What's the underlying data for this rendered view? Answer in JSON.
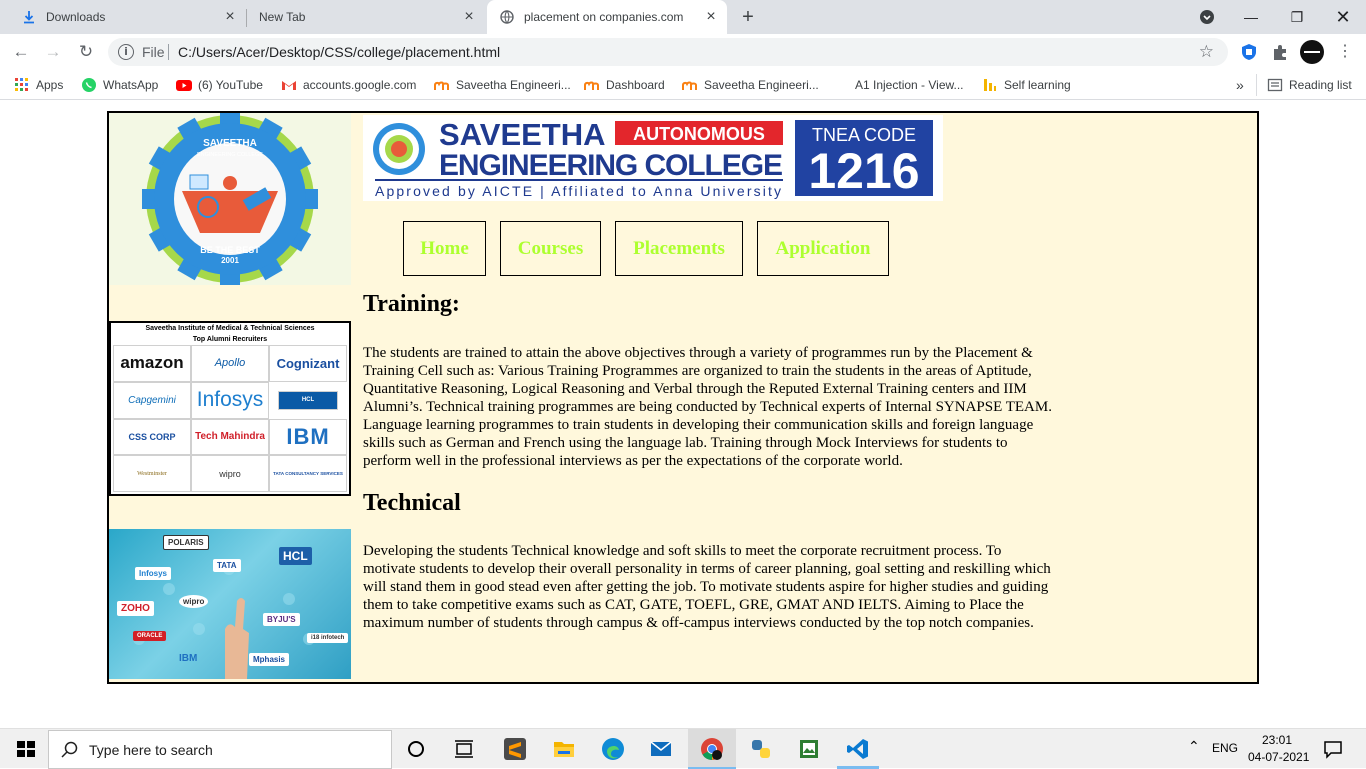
{
  "browser": {
    "tabs": [
      {
        "title": "Downloads",
        "icon": "download-icon"
      },
      {
        "title": "New Tab",
        "icon": ""
      },
      {
        "title": "placement on companies.com",
        "icon": "globe-icon",
        "active": true
      }
    ],
    "address": {
      "scheme": "File",
      "url": "C:/Users/Acer/Desktop/CSS/college/placement.html"
    },
    "bookmarks": [
      {
        "label": "Apps",
        "icon": "apps-grid-icon"
      },
      {
        "label": "WhatsApp",
        "icon": "whatsapp-icon"
      },
      {
        "label": "(6) YouTube",
        "icon": "youtube-icon"
      },
      {
        "label": "accounts.google.com",
        "icon": "gmail-icon"
      },
      {
        "label": "Saveetha Engineeri...",
        "icon": "moodle-icon"
      },
      {
        "label": "Dashboard",
        "icon": "moodle-icon"
      },
      {
        "label": "Saveetha Engineeri...",
        "icon": "moodle-icon"
      },
      {
        "label": "A1 Injection - View...",
        "icon": ""
      },
      {
        "label": "Self learning",
        "icon": "bar-icon"
      }
    ],
    "overflow": "»",
    "reading_list": "Reading list"
  },
  "page": {
    "logo": {
      "top": "SAVEETHA",
      "sub": "ENGINEERING COLLEGE",
      "motto": "BE THE BEST",
      "year": "2001"
    },
    "banner": {
      "line1": "SAVEETHA",
      "badge": "AUTONOMOUS",
      "line2": "ENGINEERING COLLEGE",
      "line3": "Approved by AICTE  |  Affiliated to Anna University",
      "tnea_label": "TNEA CODE",
      "tnea_code": "1216"
    },
    "nav": [
      "Home",
      "Courses",
      "Placements",
      "Application"
    ],
    "recruiters": {
      "header1": "Saveetha Institute of Medical & Technical Sciences",
      "header2": "Top Alumni Recruiters",
      "logos": [
        "amazon",
        "Apollo",
        "Cognizant",
        "Capgemini",
        "Infosys",
        "HCL",
        "CSS CORP",
        "Tech Mahindra",
        "IBM",
        "Westminster",
        "wipro",
        "TATA CONSULTANCY SERVICES"
      ]
    },
    "collage": [
      "POLARIS",
      "HCL",
      "Infosys",
      "TATA",
      "ZOHO",
      "wipro",
      "BYJU'S",
      "ORACLE",
      "IBM",
      "Mphasis",
      "i18 infotech"
    ],
    "sections": [
      {
        "heading": "Training:",
        "body": "The students are trained to attain the above objectives through a variety of programmes run by the Placement & Training Cell such as: Various Training Programmes are organized to train the students in the areas of Aptitude, Quantitative Reasoning, Logical Reasoning and Verbal through the Reputed External Training centers and IIM Alumni’s. Technical training programmes are being conducted by Technical experts of Internal SYNAPSE TEAM. Language learning programmes to train students in developing their communication skills and foreign language skills such as German and French using the language lab. Training through Mock Interviews for students to perform well in the professional interviews as per the expectations of the corporate world."
      },
      {
        "heading": "Technical",
        "body": "Developing the students Technical knowledge and soft skills to meet the corporate recruitment process. To motivate students to develop their overall personality in terms of career planning, goal setting and reskilling which will stand them in good stead even after getting the job. To motivate students aspire for higher studies and guiding them to take competitive exams such as CAT, GATE, TOEFL, GRE, GMAT AND IELTS. Aiming to Place the maximum number of students through campus & off-campus interviews conducted by the top notch companies."
      }
    ],
    "nav_color": "#adff2f",
    "bg_color": "#fff8dc"
  },
  "taskbar": {
    "search_placeholder": "Type here to search",
    "lang": "ENG",
    "time": "23:01",
    "date": "04-07-2021"
  }
}
